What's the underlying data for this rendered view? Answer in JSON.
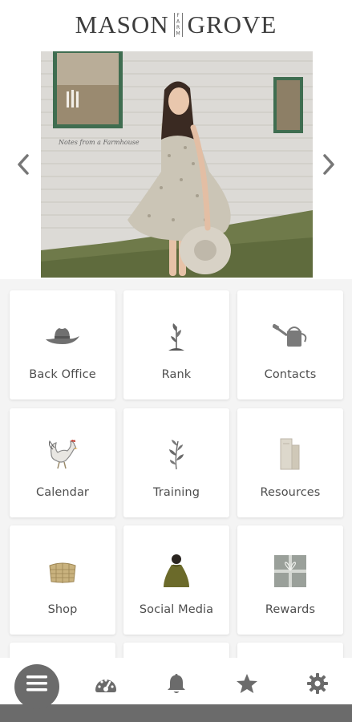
{
  "header": {
    "logo_left": "MASON",
    "logo_middle": "FARM",
    "logo_right": "GROVE"
  },
  "carousel": {
    "photo_script_text": "Notes from a Farmhouse",
    "prev_icon": "chevron-left-icon",
    "next_icon": "chevron-right-icon"
  },
  "tiles": [
    {
      "label": "Back Office",
      "icon": "cowboy-hat-icon"
    },
    {
      "label": "Rank",
      "icon": "sprout-icon"
    },
    {
      "label": "Contacts",
      "icon": "watering-can-icon"
    },
    {
      "label": "Calendar",
      "icon": "rooster-icon"
    },
    {
      "label": "Training",
      "icon": "branch-icon"
    },
    {
      "label": "Resources",
      "icon": "books-icon"
    },
    {
      "label": "Shop",
      "icon": "basket-icon"
    },
    {
      "label": "Social Media",
      "icon": "person-icon"
    },
    {
      "label": "Rewards",
      "icon": "gift-box-icon"
    }
  ],
  "bottom_nav": {
    "items": [
      "menu-icon",
      "dashboard-gauge-icon",
      "bell-icon",
      "star-icon",
      "gear-icon"
    ]
  },
  "colors": {
    "background": "#f4f4f4",
    "tile_label": "#4e4e4e",
    "icon_gray": "#6b6b6b",
    "nav_active": "#6b6b6b"
  }
}
